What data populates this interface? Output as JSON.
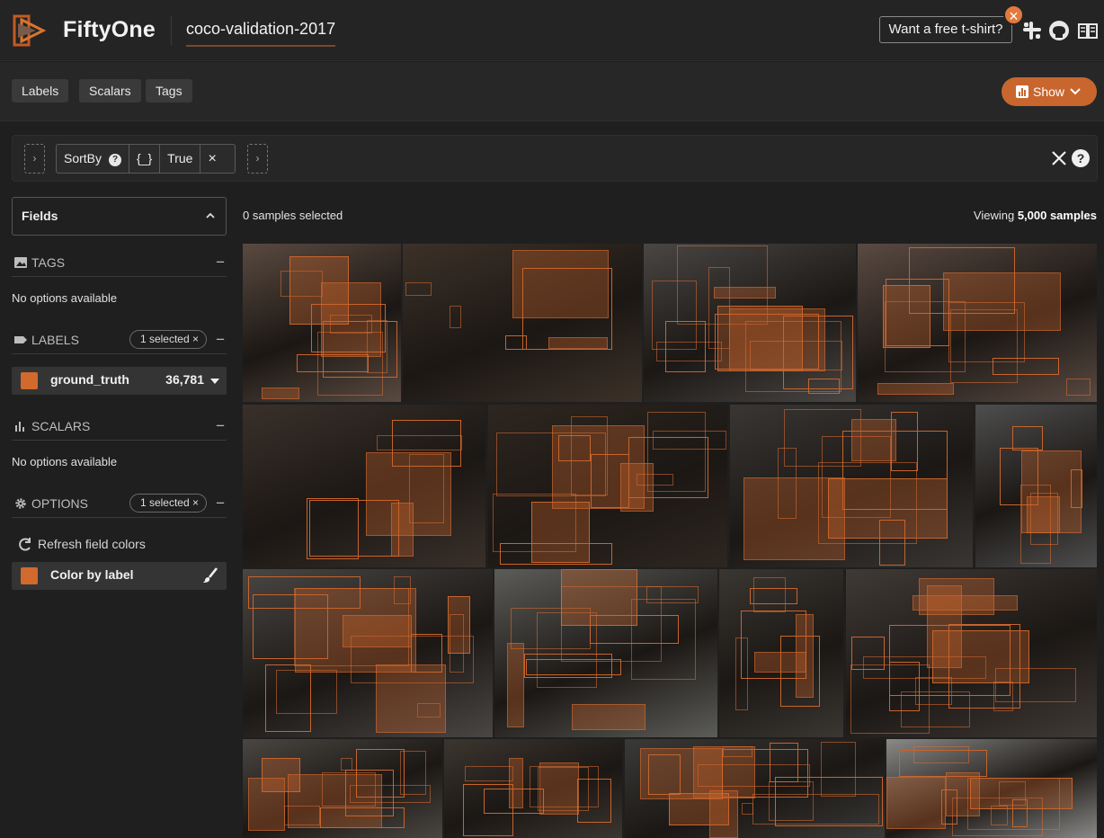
{
  "header": {
    "brand": "FiftyOne",
    "dataset": "coco-validation-2017",
    "tshirt_label": "Want a free t-shirt?",
    "close_glyph": "×",
    "icons": [
      "fiftyone-logo-icon",
      "slack-icon",
      "github-icon",
      "docs-book-icon"
    ]
  },
  "toolbar": {
    "tabs": [
      "Labels",
      "Scalars",
      "Tags"
    ],
    "show_label": "Show"
  },
  "viewbar": {
    "stage_name": "SortBy",
    "stage_help": "?",
    "stage_param": "{_}",
    "stage_value": "True",
    "stage_remove": "×",
    "help_glyph": "?"
  },
  "sidebar": {
    "fields_title": "Fields",
    "tags": {
      "label": "TAGS",
      "collapse": "−",
      "empty": "No options available"
    },
    "labels": {
      "label": "LABELS",
      "selected": "1 selected",
      "collapse": "−",
      "field": {
        "name": "ground_truth",
        "count": "36,781"
      }
    },
    "scalars": {
      "label": "SCALARS",
      "collapse": "−",
      "empty": "No options available"
    },
    "options": {
      "label": "OPTIONS",
      "selected": "1 selected",
      "collapse": "−",
      "refresh": "Refresh field colors",
      "color_by": "Color by label"
    },
    "pill_x": "×"
  },
  "grid": {
    "selected_text": "0 samples selected",
    "viewing_prefix": "Viewing",
    "viewing_count": "5,000 samples"
  },
  "colors": {
    "accent": "#c8662e",
    "box": "#c7642c",
    "bg": "#1f1f1f"
  }
}
